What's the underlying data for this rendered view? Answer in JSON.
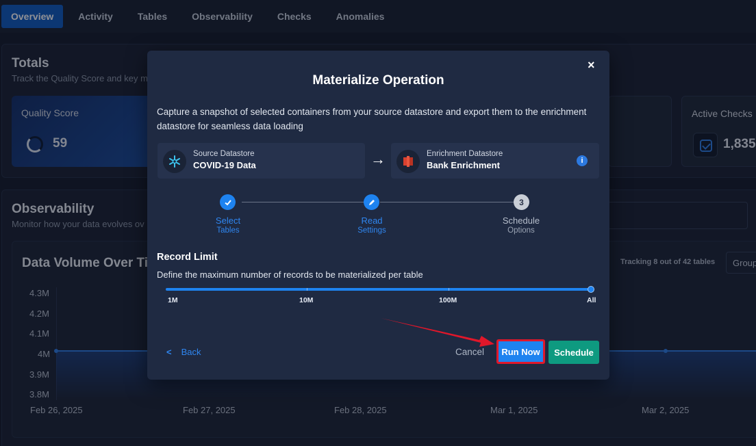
{
  "tabs": [
    "Overview",
    "Activity",
    "Tables",
    "Observability",
    "Checks",
    "Anomalies"
  ],
  "totals": {
    "title": "Totals",
    "subtitle": "Track the Quality Score and key m",
    "quality_score_label": "Quality Score",
    "quality_score_value": "59",
    "active_checks_label": "Active Checks",
    "active_checks_value": "1,835"
  },
  "observability": {
    "title": "Observability",
    "subtitle": "Monitor how your data evolves ov",
    "chart_title": "Data Volume Over Tir",
    "tracking": "Tracking 8 out of 42 tables",
    "group_label": "Group"
  },
  "chart_data": {
    "type": "line",
    "title": "Data Volume Over Tir",
    "x": [
      "Feb 26, 2025",
      "Feb 27, 2025",
      "Feb 28, 2025",
      "Mar 1, 2025",
      "Mar 2, 2025"
    ],
    "y_ticks": [
      "4.3M",
      "4.2M",
      "4.1M",
      "4M",
      "3.9M",
      "3.8M"
    ],
    "series": [
      {
        "values": [
          4000000,
          4000000,
          4000000,
          4000000,
          4000000
        ]
      }
    ]
  },
  "modal": {
    "title": "Materialize Operation",
    "close": "×",
    "description": "Capture a snapshot of selected containers from your source datastore and export them to the enrichment datastore for seamless data loading",
    "source_label": "Source Datastore",
    "source_value": "COVID-19 Data",
    "enrichment_label": "Enrichment Datastore",
    "enrichment_value": "Bank Enrichment",
    "arrow": "→",
    "info": "i",
    "steps": [
      {
        "title": "Select",
        "sub": "Tables",
        "state": "done",
        "icon": "check-icon"
      },
      {
        "title": "Read",
        "sub": "Settings",
        "state": "current",
        "icon": "pencil-icon"
      },
      {
        "title": "Schedule",
        "sub": "Options",
        "state": "todo",
        "number": "3"
      }
    ],
    "record_limit_title": "Record Limit",
    "record_limit_desc": "Define the maximum number of records to be materialized per table",
    "slider_labels": [
      "1M",
      "10M",
      "100M",
      "All"
    ],
    "slider_value": "All",
    "back": "Back",
    "cancel": "Cancel",
    "run_now": "Run Now",
    "schedule": "Schedule"
  },
  "colors": {
    "accent": "#1e83f0",
    "schedule": "#0e9a80",
    "highlight": "#e0172a"
  }
}
